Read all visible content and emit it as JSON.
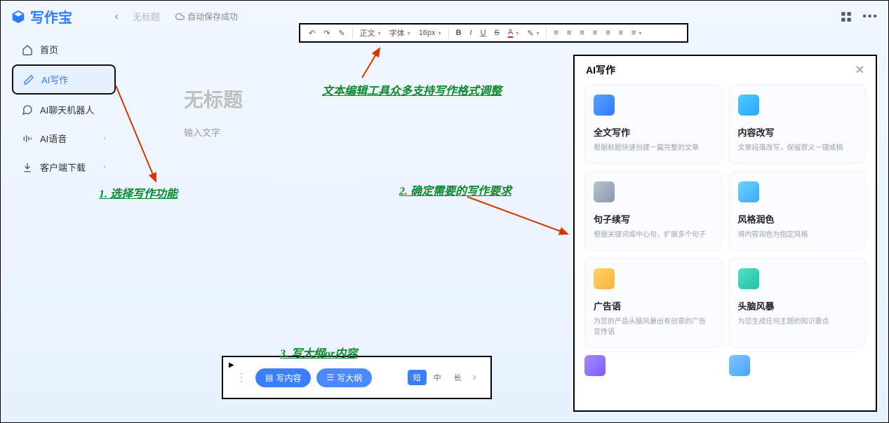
{
  "app": {
    "name": "写作宝"
  },
  "header": {
    "doc_name": "无标题",
    "save_status": "自动保存成功"
  },
  "sidebar": {
    "items": [
      {
        "label": "首页"
      },
      {
        "label": "AI写作"
      },
      {
        "label": "AI聊天机器人"
      },
      {
        "label": "AI语音"
      },
      {
        "label": "客户端下载"
      }
    ]
  },
  "toolbar": {
    "style_label": "正文",
    "font_label": "字体",
    "size_label": "16px"
  },
  "editor": {
    "title_placeholder": "无标题",
    "body_placeholder": "输入文字"
  },
  "bottom": {
    "write_content": "写内容",
    "write_outline": "写大纲",
    "len_short": "短",
    "len_mid": "中",
    "len_long": "长"
  },
  "ai_panel": {
    "title": "AI写作",
    "cards": [
      {
        "title": "全文写作",
        "desc": "根据标题快速创建一篇完整的文章"
      },
      {
        "title": "内容改写",
        "desc": "文章段落改写，保留原义一键成稿"
      },
      {
        "title": "句子续写",
        "desc": "根据关键词或中心句，扩展多个句子"
      },
      {
        "title": "风格润色",
        "desc": "将内容润色为指定风格"
      },
      {
        "title": "广告语",
        "desc": "为您的产品头脑风暴出有创意的广告宣传语"
      },
      {
        "title": "头脑风暴",
        "desc": "为您生成任何主题的知识要点"
      }
    ]
  },
  "annotations": {
    "a1": "1. 选择写作功能",
    "a2": "文本编辑工具众多支持写作格式调整",
    "a3": "2. 确定需要的写作要求",
    "a4": "3. 写大纲or内容"
  }
}
